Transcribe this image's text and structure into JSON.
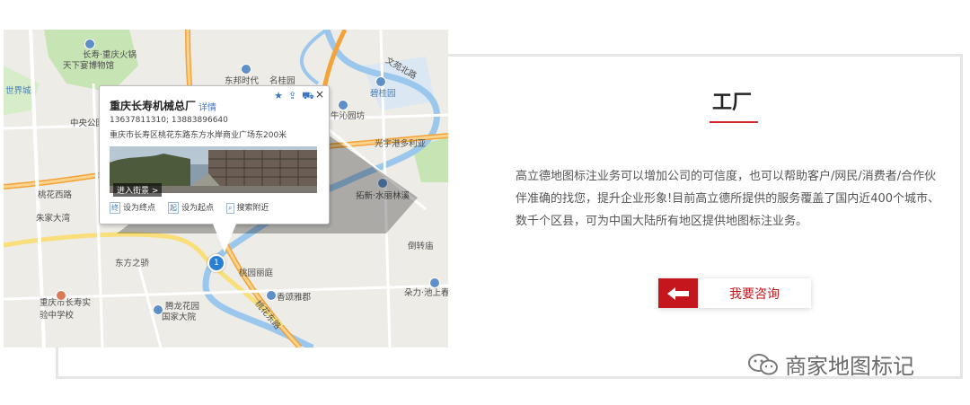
{
  "map": {
    "labels": {
      "l1": "长寿·重庆火锅",
      "l2": "天下宴博物馆",
      "l3": "东邦时代",
      "l4": "名桂园",
      "l5": "文苑北路",
      "l6": "碧桂园",
      "l7": "世界城",
      "l8": "中央公园",
      "l9": "桃花西路",
      "l10": "朱家大湾",
      "l11": "东方之骄",
      "l12": "重庆市长寿实验中学校",
      "l13": "腾龙花园",
      "l14": "国家大院",
      "l15": "桃花东路",
      "l16": "香颂雅郡",
      "l17": "倒转庙",
      "l18": "朵力·池上春天",
      "l19": "拓新·水丽林溪",
      "l20": "光宇港多利亚",
      "l21": "牛沁园坊",
      "l22": "桃园丽庭"
    },
    "marker_number": "1"
  },
  "popup": {
    "name": "重庆长寿机械总厂",
    "detail_link": "详情",
    "phone": "13637811310; 13883896640",
    "address": "重庆市长寿区桃花东路东方水岸商业广场东200米",
    "street_view": "进入街景 >",
    "close": "×",
    "actions": [
      {
        "icon": "终",
        "label": "设为终点"
      },
      {
        "icon": "起",
        "label": "设为起点"
      },
      {
        "icon": "⌕",
        "label": "搜索附近"
      }
    ]
  },
  "card": {
    "title": "工厂",
    "description": "高立德地图标注业务可以增加公司的可信度，也可以帮助客户/网民/消费者/合作伙伴准确的找您，提升企业形象!目前高立德所提供的服务覆盖了国内近400个城市、数千个区县，可为中国大陆所有地区提供地图标注业务。",
    "consult_label": "我要咨询"
  },
  "watermark": {
    "text": "商家地图标记"
  },
  "colors": {
    "accent_red": "#c4161c",
    "map_blue": "#2b7fd3"
  }
}
